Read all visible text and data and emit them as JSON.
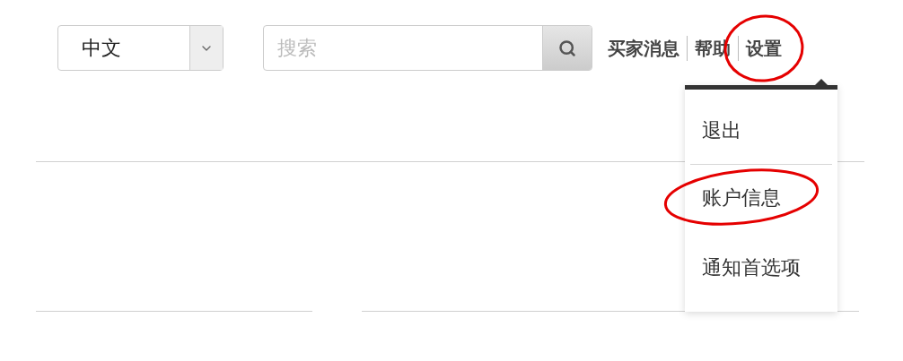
{
  "language_select": {
    "value": "中文"
  },
  "search": {
    "placeholder": "搜索"
  },
  "nav": [
    {
      "label": "买家消息",
      "circled": false
    },
    {
      "label": "帮助",
      "circled": false
    },
    {
      "label": "设置",
      "circled": true
    }
  ],
  "dropdown_menu": [
    {
      "label": "退出",
      "circled": false
    },
    {
      "label": "账户信息",
      "circled": true
    },
    {
      "label": "通知首选项",
      "circled": false
    }
  ]
}
